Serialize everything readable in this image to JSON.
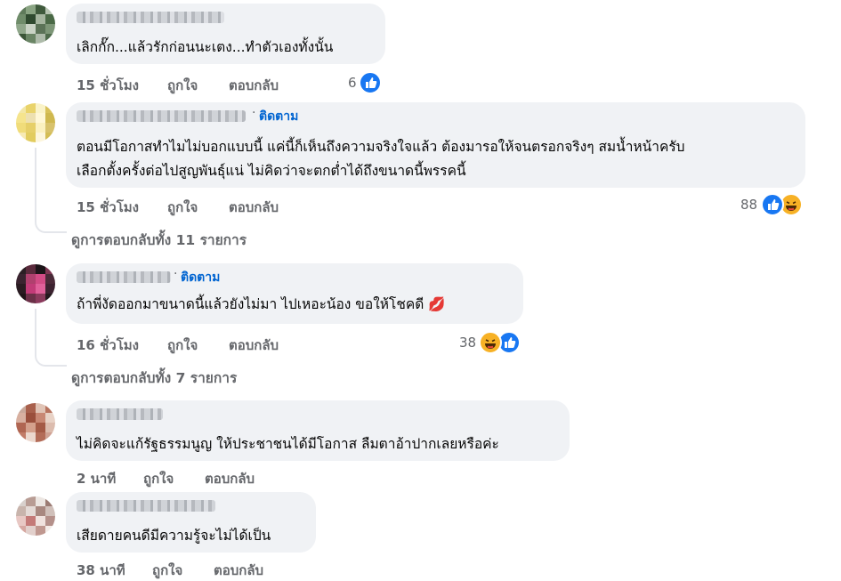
{
  "comments": [
    {
      "name_hidden": true,
      "follow_label": "",
      "text_lines": [
        "เลิกกั๊ก...แล้วรักก่อนนะเตง...ทำตัวเองทั้งนั้น"
      ],
      "time": "15 ชั่วโมง",
      "like_label": "ถูกใจ",
      "reply_label": "ตอบกลับ",
      "reaction_count": "6",
      "reactions": [
        "like-icon"
      ],
      "avatar_colors": [
        "#5e7a5a",
        "#8aa483",
        "#3f5a3c",
        "#b7c4b2",
        "#6f8c6a",
        "#2f4a2f",
        "#a5b59f",
        "#4a6946",
        "#90a78b",
        "#c9d3c5",
        "#5b7357",
        "#7d9677",
        "#3b5538",
        "#6a8565",
        "#aebbaa",
        "#4e6b4b"
      ]
    },
    {
      "name_hidden": true,
      "follow_label": "ติดตาม",
      "text_lines": [
        "ตอนมีโอกาสทำไมไม่บอกแบบนี้ แค่นี้ก็เห็นถึงความจริงใจแล้ว ต้องมารอให้จนตรอกจริงๆ สมน้ำหน้าครับ",
        "เลือกตั้งครั้งต่อไปสูญพันธุ์แน่ ไม่คิดว่าจะตกต่ำได้ถึงขนาดนี้พรรคนี้"
      ],
      "time": "15 ชั่วโมง",
      "like_label": "ถูกใจ",
      "reply_label": "ตอบกลับ",
      "reaction_count": "88",
      "reactions": [
        "like-icon",
        "haha-icon"
      ],
      "view_replies": "ดูการตอบกลับทั้ง 11 รายการ",
      "avatar_colors": [
        "#f3e7a6",
        "#e9d36a",
        "#faf3c8",
        "#d9c15a",
        "#f5e48d",
        "#ede0b0",
        "#fff7d6",
        "#cfb84f",
        "#f0dc7a",
        "#e6cf68",
        "#fbf1c0",
        "#d8c26c",
        "#f7eab4",
        "#e2cc5e",
        "#fdf6dc",
        "#d4bd55"
      ]
    },
    {
      "name_hidden": true,
      "follow_label": "ติดตาม",
      "text_lines": [
        "ถ้าพี่งัดออกมาขนาดนี้แล้วยังไม่มา ไปเหอะน้อง ขอให้โชคดี 💋"
      ],
      "time": "16 ชั่วโมง",
      "like_label": "ถูกใจ",
      "reply_label": "ตอบกลับ",
      "reaction_count": "38",
      "reactions": [
        "haha-icon",
        "like-icon"
      ],
      "view_replies": "ดูการตอบกลับทั้ง 7 รายการ",
      "avatar_colors": [
        "#2b1e24",
        "#5a2a3c",
        "#1c1418",
        "#7d3652",
        "#3a2430",
        "#b0406e",
        "#d24b85",
        "#4a2a38",
        "#2a1c22",
        "#c23b78",
        "#e0609a",
        "#3c2230",
        "#1f1519",
        "#6b3048",
        "#8a3a5c",
        "#241a1e"
      ]
    },
    {
      "name_hidden": true,
      "follow_label": "",
      "text_lines": [
        "ไม่คิดจะแก้รัฐธรรมนูญ ให้ประชาชนได้มีโอกาส ลืมตาอ้าปากเลยหรือค่ะ"
      ],
      "time": "2 นาที",
      "like_label": "ถูกใจ",
      "reply_label": "ตอบกลับ",
      "reaction_count": "",
      "reactions": [],
      "avatar_colors": [
        "#c9a89a",
        "#a8604c",
        "#e0c4b6",
        "#b8735e",
        "#d8b0a0",
        "#9a4f3c",
        "#c88874",
        "#e8d2c6",
        "#b06652",
        "#d4a08c",
        "#a45a46",
        "#dcbcae",
        "#c27c68",
        "#ecd8ce",
        "#b36c58",
        "#cfa294"
      ]
    },
    {
      "name_hidden": true,
      "follow_label": "",
      "text_lines": [
        "เสียดายคนดีมีความรู้จะไม่ได้เป็น"
      ],
      "time": "38 นาที",
      "like_label": "ถูกใจ",
      "reply_label": "ตอบกลับ",
      "reaction_count": "",
      "reactions": [],
      "avatar_colors": [
        "#d8d0cc",
        "#b89c94",
        "#ece6e2",
        "#9c7c74",
        "#c8b4ac",
        "#e4dad6",
        "#a88880",
        "#d0c0ba",
        "#e8c8c4",
        "#c47a78",
        "#f0e2de",
        "#b4908a",
        "#d6a8a2",
        "#e2d0cc",
        "#c09890",
        "#f4ece8"
      ]
    }
  ]
}
